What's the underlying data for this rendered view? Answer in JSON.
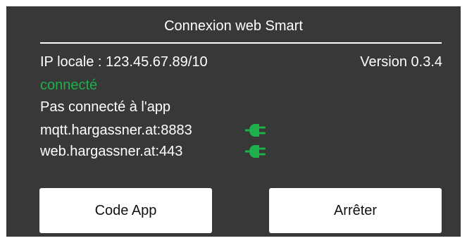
{
  "header": {
    "title": "Connexion web Smart"
  },
  "info": {
    "ip_label": "IP locale : 123.45.67.89/10",
    "version": "Version 0.3.4",
    "connection_status": "connecté",
    "app_status": "Pas connecté à l'app"
  },
  "servers": [
    {
      "address": "mqtt.hargassner.at:8883",
      "icon": "plug-icon"
    },
    {
      "address": "web.hargassner.at:443",
      "icon": "plug-icon"
    }
  ],
  "buttons": {
    "code_app": "Code App",
    "stop": "Arrêter"
  },
  "colors": {
    "panel_background": "#383838",
    "status_green": "#1eb04a",
    "text": "#ffffff",
    "button_background": "#ffffff"
  }
}
